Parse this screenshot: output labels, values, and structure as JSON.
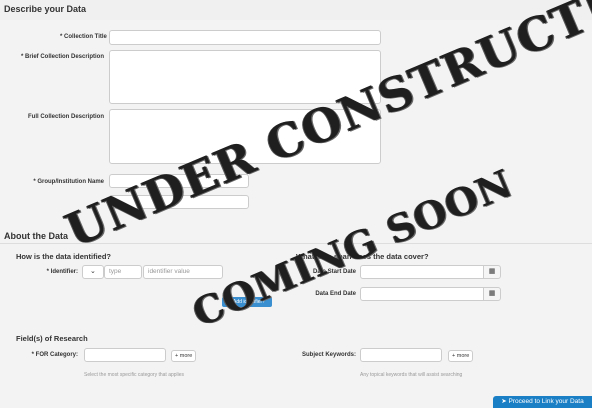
{
  "describe": {
    "title": "Describe your Data",
    "collection_title_label": "* Collection Title",
    "brief_label": "* Brief Collection Description",
    "full_label": "Full Collection Description",
    "group_label": "* Group/Institution Name"
  },
  "about": {
    "title": "About the Data",
    "identified_title": "How is the data identified?",
    "coverage_title": "What time span does the data cover?",
    "identifier_label": "* Identifier:",
    "type_placeholder": "type",
    "identifier_placeholder": "identifier value",
    "add_identifier_button": "+ Add identifier?",
    "start_date_label": "Data Start Date",
    "end_date_label": "Data End Date",
    "calendar_icon": "calendar-icon"
  },
  "research": {
    "title": "Field(s) of Research",
    "for_label": "* FOR Category:",
    "for_more": "more",
    "for_hint": "Select the most specific category that applies",
    "keywords_label": "Subject Keywords:",
    "keywords_more": "more",
    "keywords_hint": "Any topical keywords that will assist searching"
  },
  "footer": {
    "proceed_button": "Proceed to Link your Data"
  },
  "overlay": {
    "under": "UNDER CONSTRUCTION",
    "coming": "COMING SOON"
  }
}
